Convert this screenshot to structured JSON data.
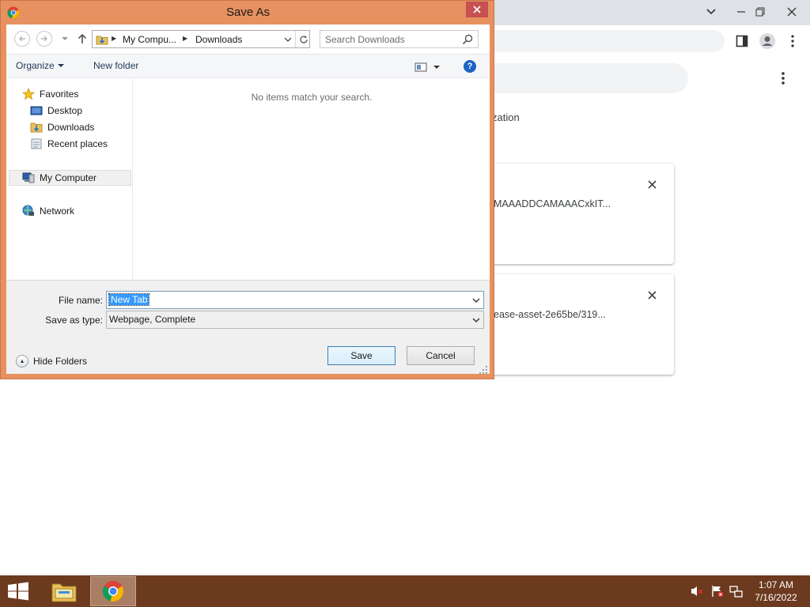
{
  "background_app": {
    "page_text": "zation",
    "downloads": [
      {
        "text": "MAAADDCAMAAACxkIT..."
      },
      {
        "text": "ease-asset-2e65be/319..."
      }
    ]
  },
  "dialog": {
    "title": "Save As",
    "breadcrumb": [
      "My Compu...",
      "Downloads"
    ],
    "search_placeholder": "Search Downloads",
    "toolbar": {
      "organize_label": "Organize",
      "new_folder_label": "New folder"
    },
    "nav_pane": {
      "favorites_label": "Favorites",
      "favorites_items": [
        "Desktop",
        "Downloads",
        "Recent places"
      ],
      "computer_label": "My Computer",
      "network_label": "Network"
    },
    "empty_message": "No items match your search.",
    "form": {
      "file_name_label": "File name:",
      "file_name_value": "New Tab",
      "save_type_label": "Save as type:",
      "save_type_value": "Webpage, Complete"
    },
    "hide_folders_label": "Hide Folders",
    "save_label": "Save",
    "cancel_label": "Cancel"
  },
  "taskbar": {
    "time": "1:07 AM",
    "date": "7/16/2022"
  },
  "colors": {
    "dialog_frame": "#e6915f",
    "taskbar": "#6b3a1f",
    "selection": "#3399ff"
  }
}
